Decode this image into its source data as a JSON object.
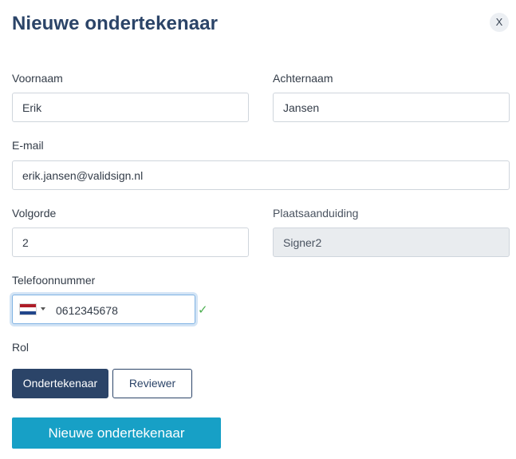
{
  "dialog": {
    "title": "Nieuwe ondertekenaar",
    "close_label": "X"
  },
  "form": {
    "first_name": {
      "label": "Voornaam",
      "value": "Erik"
    },
    "last_name": {
      "label": "Achternaam",
      "value": "Jansen"
    },
    "email": {
      "label": "E-mail",
      "value": "erik.jansen@validsign.nl"
    },
    "order": {
      "label": "Volgorde",
      "value": "2"
    },
    "placeholder_field": {
      "label": "Plaatsaanduiding",
      "value": "Signer2"
    },
    "phone": {
      "label": "Telefoonnummer",
      "value": "0612345678",
      "country_flag": "netherlands-flag",
      "valid_mark": "✓",
      "valid_color": "#4caf50"
    },
    "role": {
      "label": "Rol",
      "options": [
        "Ondertekenaar",
        "Reviewer"
      ],
      "selected": "Ondertekenaar"
    }
  },
  "submit_label": "Nieuwe ondertekenaar",
  "colors": {
    "primary": "#2b4468",
    "accent": "#17a0c6"
  }
}
